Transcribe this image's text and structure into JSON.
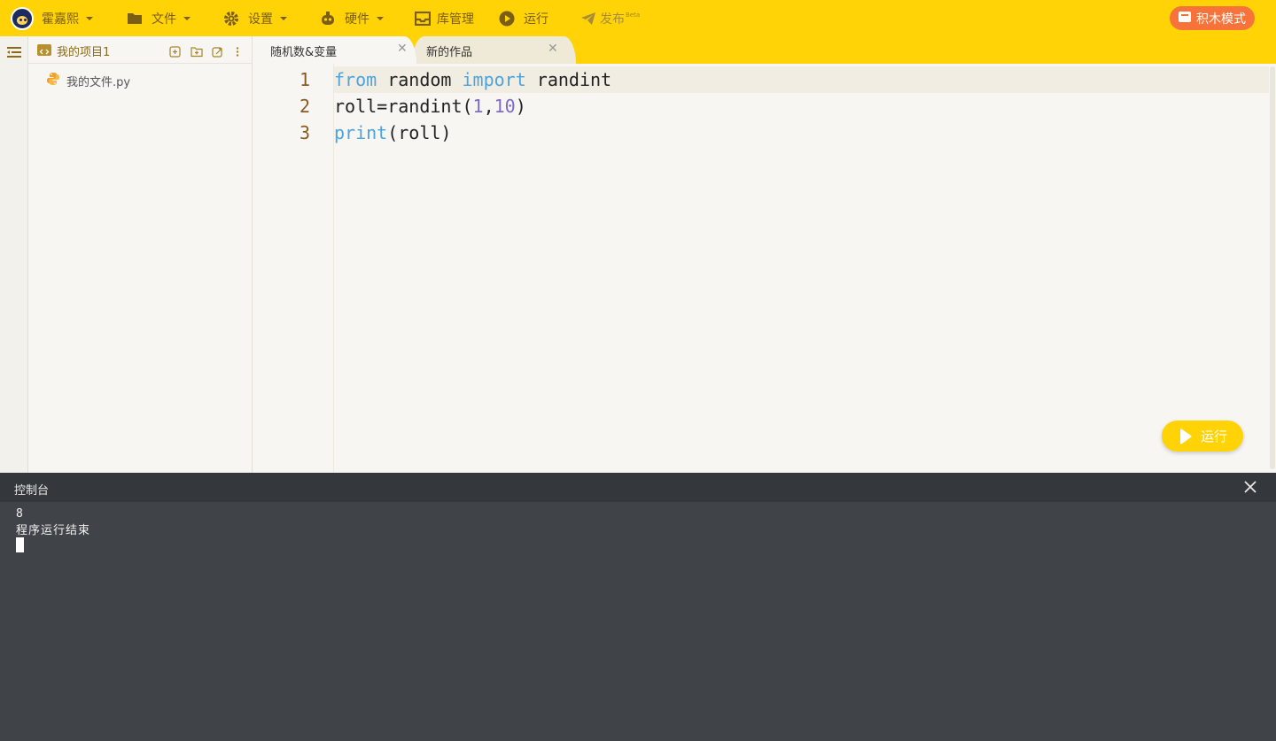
{
  "topbar": {
    "user_name": "霍嘉熙",
    "file_menu": "文件",
    "settings_menu": "设置",
    "hardware_menu": "硬件",
    "library": "库管理",
    "run": "运行",
    "publish": "发布",
    "publish_badge": "Beta",
    "blocks_mode": "积木模式",
    "accent_color": "#ffd306",
    "blocks_button_color": "#f7733a"
  },
  "file_panel": {
    "project_title": "我的项目1",
    "files": [
      {
        "name": "我的文件.py",
        "icon": "python-icon"
      }
    ]
  },
  "tabs": [
    {
      "label": "随机数&变量",
      "active": true
    },
    {
      "label": "新的作品",
      "active": false
    }
  ],
  "editor": {
    "line_numbers": [
      "1",
      "2",
      "3"
    ],
    "line1": {
      "kw1": "from",
      "t1": " random ",
      "kw2": "import",
      "t2": " randint"
    },
    "line2": {
      "t1": "roll=randint(",
      "n1": "1",
      "t2": ",",
      "n2": "10",
      "t3": ")"
    },
    "line3": {
      "kw1": "print",
      "t1": "(roll)"
    },
    "run_button": "运行"
  },
  "console": {
    "title": "控制台",
    "output": [
      "8",
      "程序运行结束"
    ]
  }
}
